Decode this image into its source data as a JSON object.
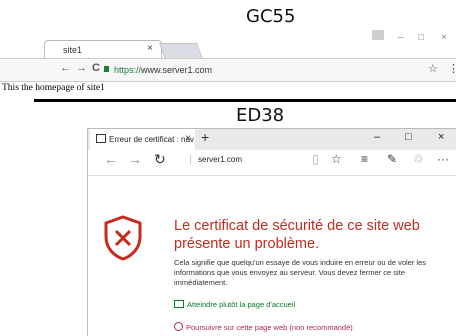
{
  "top": {
    "label": "GC55",
    "tab_title": "site1",
    "tab_close": "×",
    "win_min": "–",
    "win_max": "□",
    "win_close": "×",
    "back": "←",
    "forward": "→",
    "reload": "C",
    "url_scheme": "https://",
    "url_host": "www.server1.com",
    "star": "☆",
    "menu": "⋮",
    "page_text": "This the homepage of site1"
  },
  "bottom": {
    "label": "ED38",
    "tab_title": "Erreur de certificat : nav",
    "tab_close": "×",
    "new_tab": "+",
    "win_min": "–",
    "win_max": "□",
    "win_close": "×",
    "back": "←",
    "forward": "→",
    "refresh": "↻",
    "url": "server1.com",
    "reading": "▯",
    "favorite": "☆",
    "hub": "≡",
    "notes": "✎",
    "share": "♲",
    "more": "···",
    "error_title_1": "Le certificat de sécurité de ce site web",
    "error_title_2": "présente un problème.",
    "error_body": "Cela signifie que quelqu'un essaye de vous induire en erreur ou de voler les informations que vous envoyez au serveur. Vous devez fermer ce site immédiatement.",
    "link_home": "Atteindre plutôt la page d'accueil",
    "link_continue": "Poursuivre sur cette page web (non recommandé)"
  },
  "colors": {
    "error_red": "#c42b1c",
    "link_green": "#0a7b22",
    "link_pink": "#b0245e"
  }
}
